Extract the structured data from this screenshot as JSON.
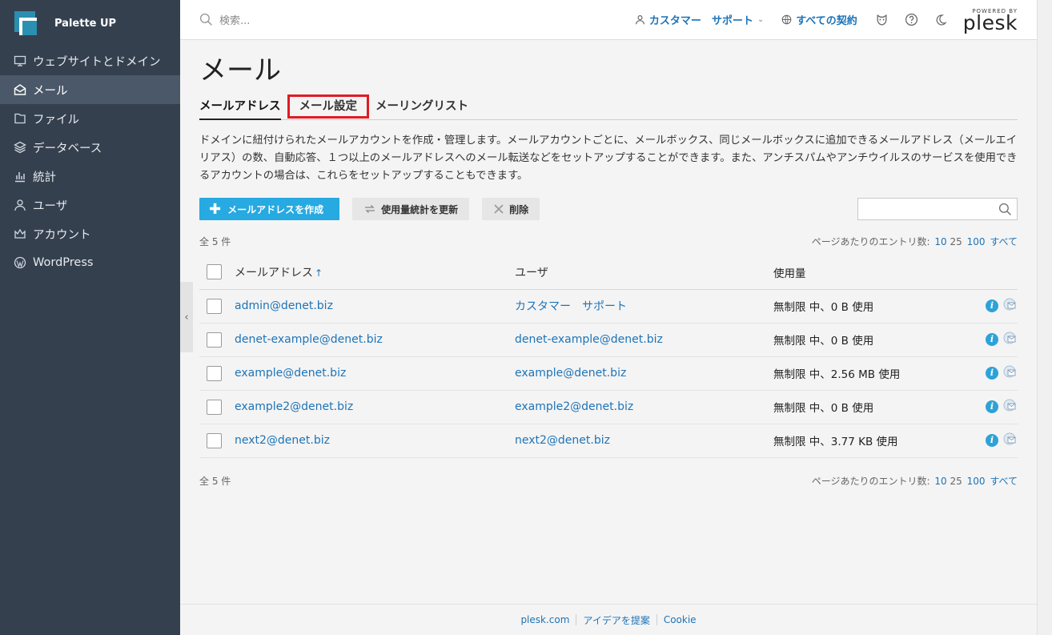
{
  "brand": {
    "name": "Palette UP"
  },
  "sidebar": {
    "items": [
      {
        "label": "ウェブサイトとドメイン",
        "icon": "monitor-icon"
      },
      {
        "label": "メール",
        "icon": "mail-icon",
        "active": true
      },
      {
        "label": "ファイル",
        "icon": "file-icon"
      },
      {
        "label": "データベース",
        "icon": "database-icon"
      },
      {
        "label": "統計",
        "icon": "stats-icon"
      },
      {
        "label": "ユーザ",
        "icon": "user-icon"
      },
      {
        "label": "アカウント",
        "icon": "crown-icon"
      },
      {
        "label": "WordPress",
        "icon": "wordpress-icon"
      }
    ]
  },
  "topbar": {
    "search_placeholder": "検索...",
    "user_link": "カスタマー　サポート",
    "subscriptions_link": "すべての契約",
    "powered_by": "POWERED BY",
    "plesk": "plesk"
  },
  "page": {
    "title": "メール",
    "tabs": [
      "メールアドレス",
      "メール設定",
      "メーリングリスト"
    ],
    "description": "ドメインに紐付けられたメールアカウントを作成・管理します。メールアカウントごとに、メールボックス、同じメールボックスに追加できるメールアドレス（メールエイリアス）の数、自動応答、１つ以上のメールアドレスへのメール転送などをセットアップすることができます。また、アンチスパムやアンチウイルスのサービスを使用できるアカウントの場合は、これらをセットアップすることもできます。"
  },
  "toolbar": {
    "create_label": "メールアドレスを作成",
    "refresh_label": "使用量統計を更新",
    "delete_label": "削除"
  },
  "list": {
    "total": "全 5 件",
    "per_page_label": "ページあたりのエントリ数:",
    "per_page_options": [
      "10",
      "25",
      "100",
      "すべて"
    ],
    "columns": [
      "メールアドレス",
      "ユーザ",
      "使用量"
    ],
    "sort_indicator": "↑",
    "rows": [
      {
        "email": "admin@denet.biz",
        "user": "カスタマー　サポート",
        "usage": "無制限 中、0 B 使用"
      },
      {
        "email": "denet-example@denet.biz",
        "user": "denet-example@denet.biz",
        "usage": "無制限 中、0 B 使用"
      },
      {
        "email": "example@denet.biz",
        "user": "example@denet.biz",
        "usage": "無制限 中、2.56 MB 使用"
      },
      {
        "email": "example2@denet.biz",
        "user": "example2@denet.biz",
        "usage": "無制限 中、0 B 使用"
      },
      {
        "email": "next2@denet.biz",
        "user": "next2@denet.biz",
        "usage": "無制限 中、3.77 KB 使用"
      }
    ]
  },
  "footer": {
    "links": [
      "plesk.com",
      "アイデアを提案",
      "Cookie"
    ]
  },
  "colors": {
    "sidebar": "#35404f",
    "accent": "#27a9e1",
    "link": "#1d74b8",
    "highlight": "#e01b24"
  }
}
